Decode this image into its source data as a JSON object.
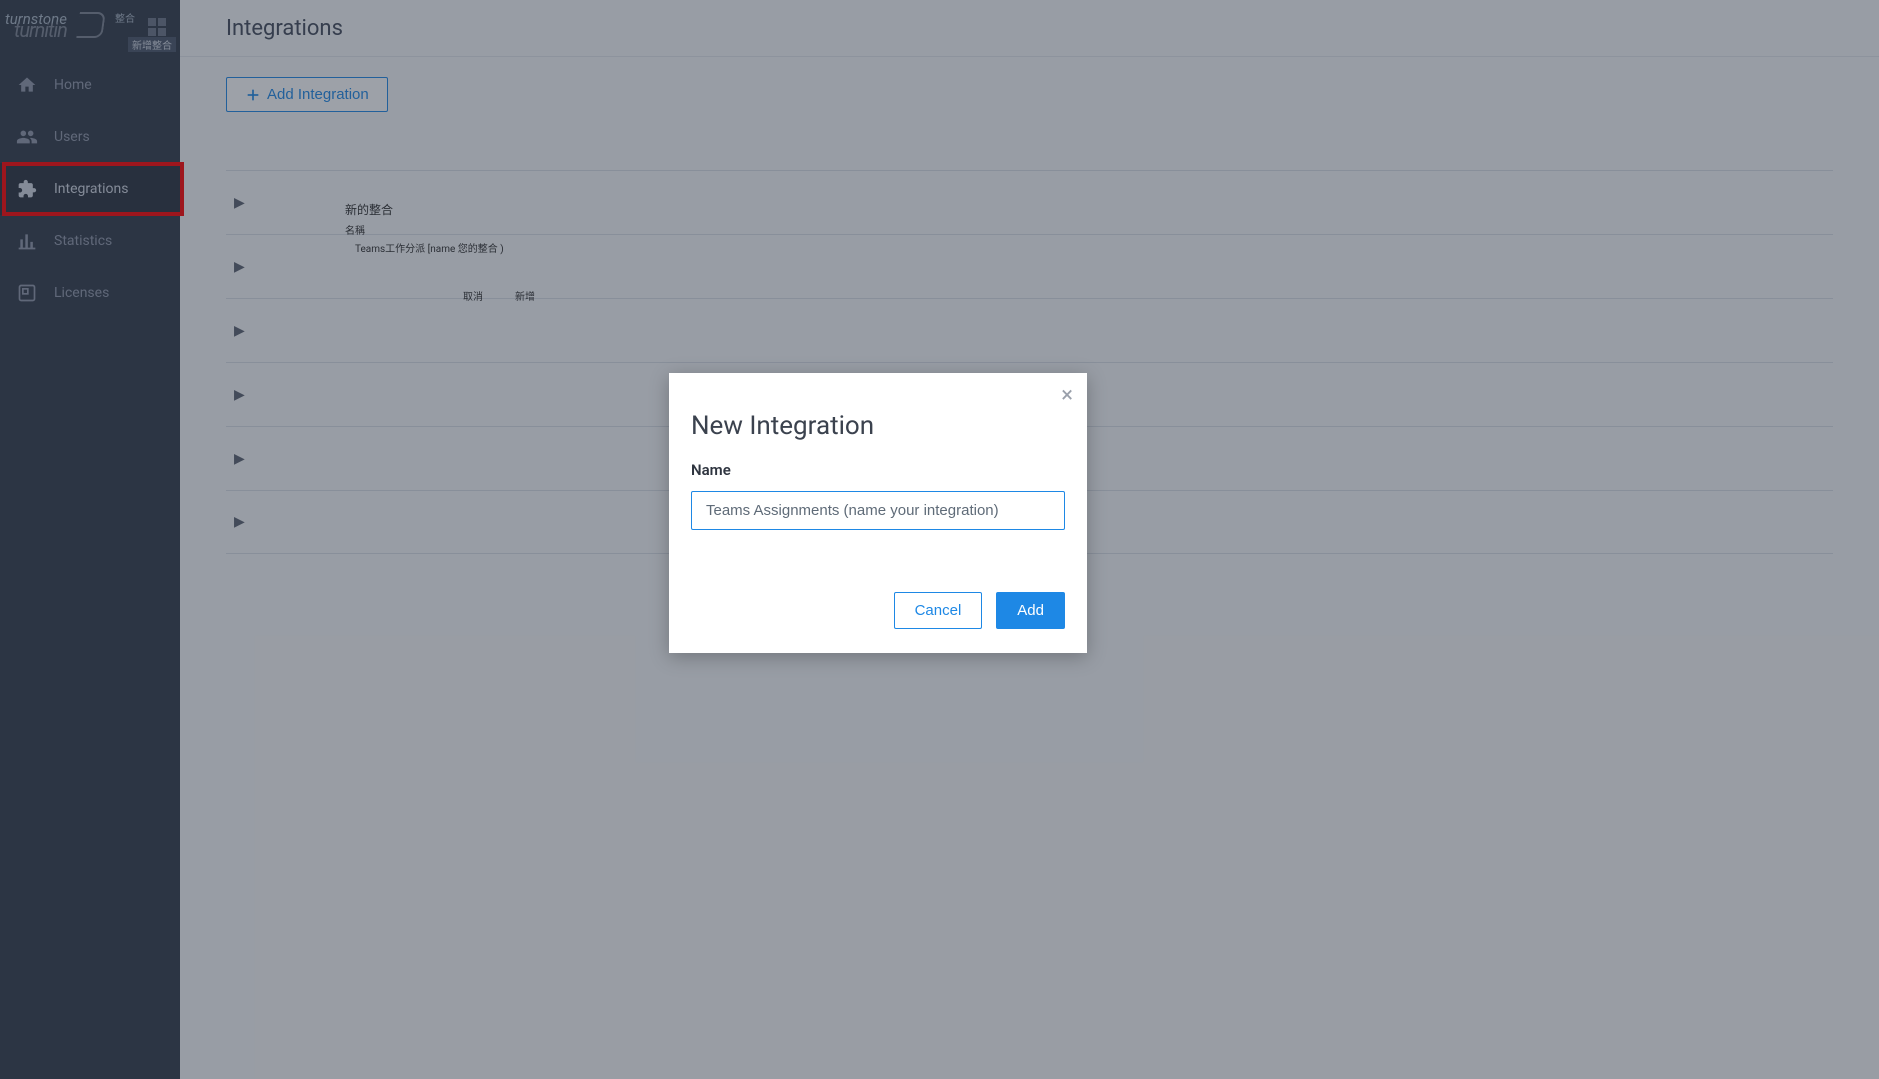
{
  "brand": {
    "top": "turnstone",
    "bottom": "turnitin",
    "tag1": "整合",
    "tag2": "新增整合"
  },
  "page": {
    "title": "Integrations",
    "add_button": "Add Integration"
  },
  "sidebar": {
    "items": [
      {
        "label": "Home"
      },
      {
        "label": "Users"
      },
      {
        "label": "Integrations"
      },
      {
        "label": "Statistics"
      },
      {
        "label": "Licenses"
      }
    ]
  },
  "cn_overlay": {
    "title": "新的整合",
    "name_label": "名稱",
    "name_value": "Teams工作分派  [name 您的整合 )",
    "cancel": "取消",
    "add": "新增"
  },
  "modal": {
    "title": "New Integration",
    "field_label": "Name",
    "input_value": "Teams Assignments (name your integration)",
    "cancel_label": "Cancel",
    "add_label": "Add"
  },
  "list": {
    "row_count": 6
  }
}
